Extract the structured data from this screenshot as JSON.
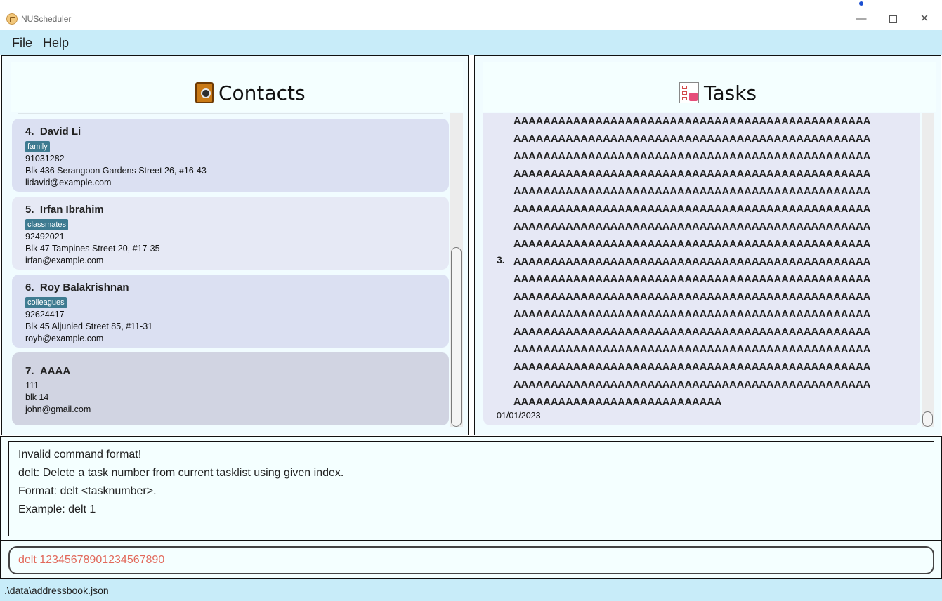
{
  "window": {
    "title": "NUScheduler"
  },
  "menu": {
    "file": "File",
    "help": "Help"
  },
  "contacts": {
    "title": "Contacts",
    "items": [
      {
        "index": "4.",
        "name": "David Li",
        "tag": "family",
        "phone": "91031282",
        "address": "Blk 436 Serangoon Gardens Street 26, #16-43",
        "email": "lidavid@example.com"
      },
      {
        "index": "5.",
        "name": "Irfan Ibrahim",
        "tag": "classmates",
        "phone": "92492021",
        "address": "Blk 47 Tampines Street 20, #17-35",
        "email": "irfan@example.com"
      },
      {
        "index": "6.",
        "name": "Roy Balakrishnan",
        "tag": "colleagues",
        "phone": "92624417",
        "address": "Blk 45 Aljunied Street 85, #11-31",
        "email": "royb@example.com"
      },
      {
        "index": "7.",
        "name": "AAAA",
        "phone": "111",
        "address": "blk 14",
        "email": "john@gmail.com"
      }
    ]
  },
  "tasks": {
    "title": "Tasks",
    "index": "3.",
    "lines": [
      "AAAAAAAAAAAAAAAAAAAAAAAAAAAAAAAAAAAAAAAAAAAAAAAA",
      "AAAAAAAAAAAAAAAAAAAAAAAAAAAAAAAAAAAAAAAAAAAAAAAA",
      "AAAAAAAAAAAAAAAAAAAAAAAAAAAAAAAAAAAAAAAAAAAAAAAA",
      "AAAAAAAAAAAAAAAAAAAAAAAAAAAAAAAAAAAAAAAAAAAAAAAA",
      "AAAAAAAAAAAAAAAAAAAAAAAAAAAAAAAAAAAAAAAAAAAAAAAA",
      "AAAAAAAAAAAAAAAAAAAAAAAAAAAAAAAAAAAAAAAAAAAAAAAA",
      "AAAAAAAAAAAAAAAAAAAAAAAAAAAAAAAAAAAAAAAAAAAAAAAA",
      "AAAAAAAAAAAAAAAAAAAAAAAAAAAAAAAAAAAAAAAAAAAAAAAA",
      "AAAAAAAAAAAAAAAAAAAAAAAAAAAAAAAAAAAAAAAAAAAAAAAA",
      "AAAAAAAAAAAAAAAAAAAAAAAAAAAAAAAAAAAAAAAAAAAAAAAA",
      "AAAAAAAAAAAAAAAAAAAAAAAAAAAAAAAAAAAAAAAAAAAAAAAA",
      "AAAAAAAAAAAAAAAAAAAAAAAAAAAAAAAAAAAAAAAAAAAAAAAA",
      "AAAAAAAAAAAAAAAAAAAAAAAAAAAAAAAAAAAAAAAAAAAAAAAA",
      "AAAAAAAAAAAAAAAAAAAAAAAAAAAAAAAAAAAAAAAAAAAAAAAA",
      "AAAAAAAAAAAAAAAAAAAAAAAAAAAAAAAAAAAAAAAAAAAAAAAA",
      "AAAAAAAAAAAAAAAAAAAAAAAAAAAAAAAAAAAAAAAAAAAAAAAA",
      "AAAAAAAAAAAAAAAAAAAAAAAAAAAA"
    ],
    "date": "01/01/2023"
  },
  "result": {
    "line1": "Invalid command format!",
    "line2": "delt: Delete a task number from current tasklist using given index.",
    "line3": "Format: delt <tasknumber>.",
    "line4": "Example: delt 1"
  },
  "command": {
    "value": "delt 12345678901234567890"
  },
  "status": {
    "path": ".\\data\\addressbook.json"
  }
}
